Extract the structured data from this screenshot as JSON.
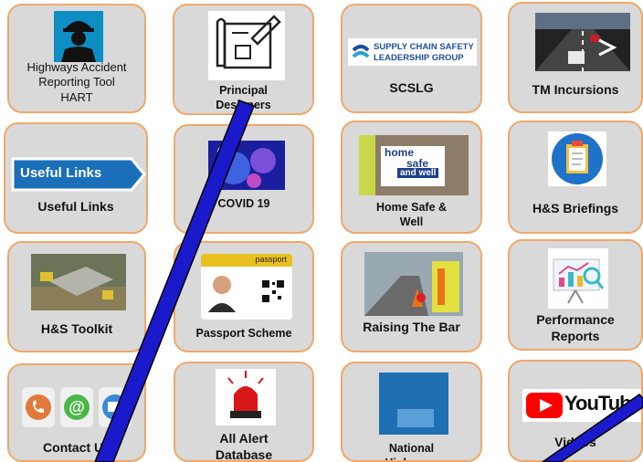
{
  "tiles": {
    "hart": {
      "label": "Highways Accident Reporting Tool HART"
    },
    "pdwg": {
      "label": "Principal Designers Working Group"
    },
    "scslg": {
      "label": "SCSLG",
      "logo_line1": "SUPPLY CHAIN SAFETY",
      "logo_line2": "LEADERSHIP GROUP"
    },
    "tm": {
      "label": "TM Incursions"
    },
    "useful": {
      "label": "Useful Links",
      "banner": "Useful Links"
    },
    "covid": {
      "label": "COVID 19"
    },
    "hsw": {
      "label": "Home Safe & Well",
      "logo_line1": "home",
      "logo_line2": "safe",
      "logo_line3": "and well"
    },
    "briefings": {
      "label": "H&S Briefings"
    },
    "toolkit": {
      "label": "H&S Toolkit"
    },
    "passport": {
      "label": "Passport Scheme",
      "card_title": "passport"
    },
    "rtb": {
      "label": "Raising The Bar"
    },
    "perf": {
      "label": "Performance Reports"
    },
    "contact": {
      "label": "Contact Us"
    },
    "alert": {
      "label": "All Alert Database"
    },
    "national": {
      "label": "National Highways Alerts"
    },
    "video": {
      "label": "Videos",
      "logo": "YouTube"
    }
  },
  "colors": {
    "tile_bg": "#d9d9d9",
    "tile_border": "#f0a86a",
    "overlay_line": "#1a1acc"
  }
}
